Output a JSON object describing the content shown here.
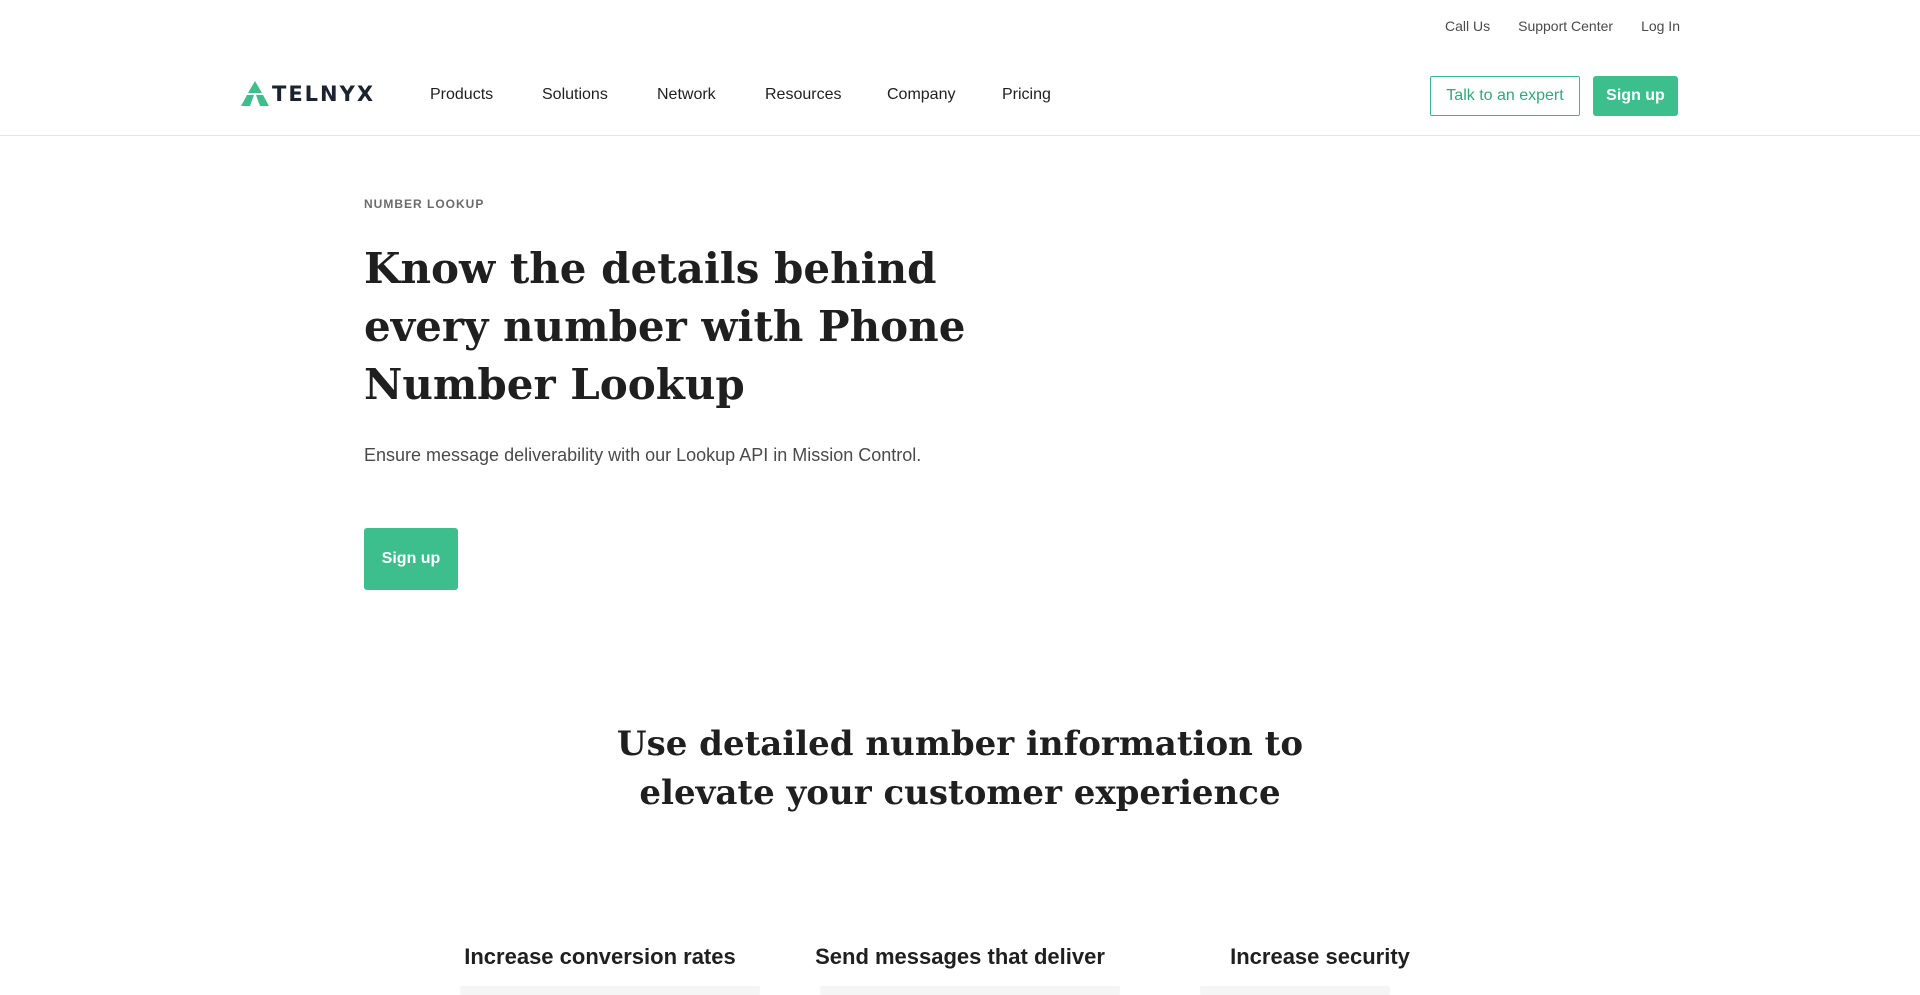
{
  "utility_nav": {
    "call_us": "Call Us",
    "support_center": "Support Center",
    "log_in": "Log In"
  },
  "brand": {
    "name": "TELNYX",
    "logo_icon": "telnyx-triangle-logo",
    "accent_color": "#3cbf8d"
  },
  "main_nav": {
    "items": [
      {
        "label": "Products"
      },
      {
        "label": "Solutions"
      },
      {
        "label": "Network"
      },
      {
        "label": "Resources"
      },
      {
        "label": "Company"
      },
      {
        "label": "Pricing"
      }
    ],
    "talk_to_expert": "Talk to an expert",
    "sign_up": "Sign up"
  },
  "hero": {
    "eyebrow": "NUMBER LOOKUP",
    "title": "Know the details behind every number with Phone Number Lookup",
    "subtitle": "Ensure message deliverability with our Lookup API in Mission Control.",
    "cta": "Sign up"
  },
  "section": {
    "title": "Use detailed number information to elevate your customer experience",
    "features": [
      {
        "title": "Increase conversion rates"
      },
      {
        "title": "Send messages that deliver"
      },
      {
        "title": "Increase security"
      }
    ]
  }
}
